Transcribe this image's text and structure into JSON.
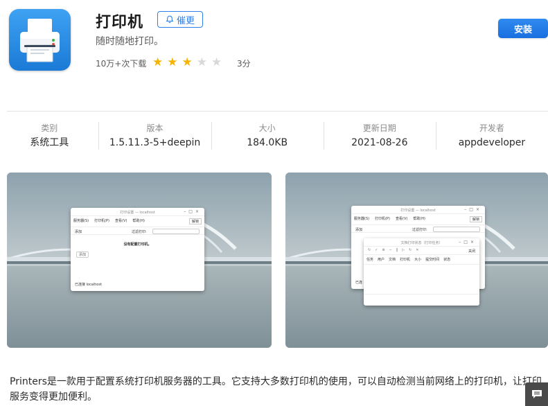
{
  "app": {
    "title": "打印机",
    "remind_label": "催更",
    "subtitle": "随时随地打印。",
    "downloads": "10万+次下载",
    "rating": 3,
    "rating_max": 5,
    "score": "3分",
    "install_label": "安装",
    "accent": "#2b7fe6",
    "star_color": "#f5b400"
  },
  "info": [
    {
      "label": "类别",
      "value": "系统工具"
    },
    {
      "label": "版本",
      "value": "1.5.11.3-5+deepin"
    },
    {
      "label": "大小",
      "value": "184.0KB"
    },
    {
      "label": "更新日期",
      "value": "2021-08-26"
    },
    {
      "label": "开发者",
      "value": "appdeveloper"
    }
  ],
  "screenshots": {
    "shot1": {
      "title": "打印设置 — localhost",
      "menu": [
        "服务器(S)",
        "打印机(P)",
        "查看(V)",
        "帮助(H)"
      ],
      "add_label": "添加",
      "filter_label": "过滤打印:",
      "unlock_label": "解锁",
      "empty_text": "没有配置打印机。",
      "add_button": "添加",
      "status": "已连接 localhost"
    },
    "shot2": {
      "title": "打印设置 — localhost",
      "menu": [
        "服务器(S)",
        "打印机(P)",
        "查看(V)",
        "帮助(H)"
      ],
      "add_label": "添加",
      "filter_label": "过滤打印:",
      "unlock_label": "解锁",
      "status": "已连",
      "dialog_title": "文档打印状态（打印任务）",
      "dialog_close": "关闭",
      "columns": [
        "任务",
        "用户",
        "文档",
        "打印机",
        "大小",
        "提交时间",
        "状态"
      ]
    }
  },
  "description": "Printers是一款用于配置系统打印机服务器的工具。它支持大多数打印机的使用，可以自动检测当前网络上的打印机，让打印服务变得更加便利。",
  "feedback_icon": "feedback-icon"
}
